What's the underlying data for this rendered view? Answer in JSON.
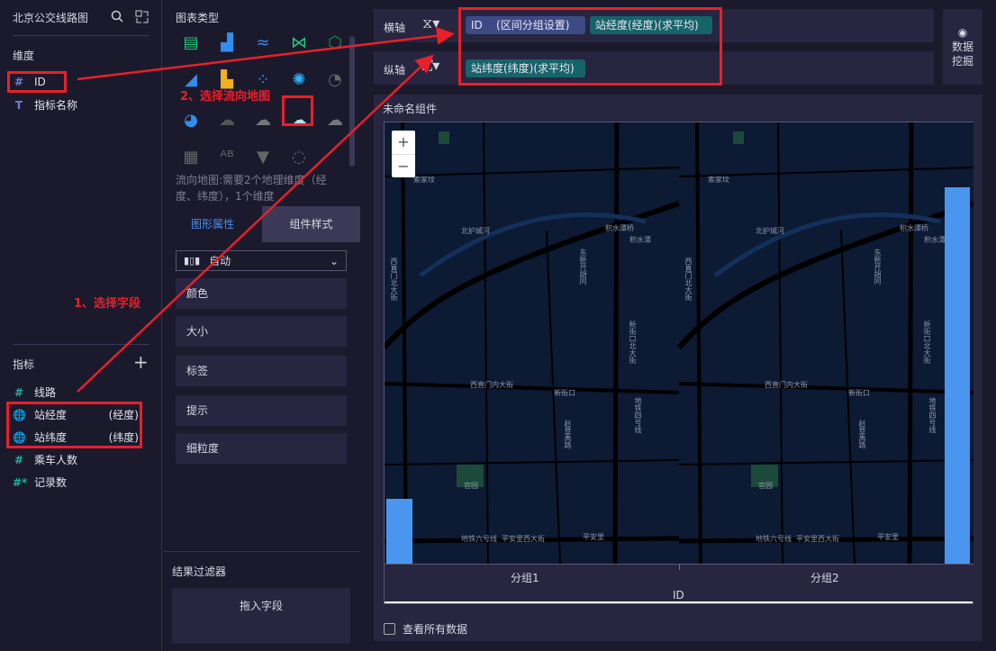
{
  "left": {
    "title": "北京公交线路图",
    "dim_title": "维度",
    "dims": [
      {
        "icon": "#",
        "label": "ID"
      },
      {
        "icon": "T",
        "label": "指标名称"
      }
    ],
    "meas_title": "指标",
    "measures": [
      {
        "icon": "#",
        "label": "线路",
        "tag": ""
      },
      {
        "icon": "globe",
        "label": "站经度",
        "tag": "(经度)"
      },
      {
        "icon": "globe",
        "label": "站纬度",
        "tag": "(纬度)"
      },
      {
        "icon": "#",
        "label": "乘车人数",
        "tag": ""
      },
      {
        "icon": "#*",
        "label": "记录数",
        "tag": ""
      }
    ]
  },
  "mid": {
    "chart_type_title": "图表类型",
    "selected_chart": "flow-map",
    "desc": "流向地图:需要2个地理维度（经度、纬度），1个维度",
    "tabs": [
      "图形属性",
      "组件样式"
    ],
    "active_tab": 0,
    "select_value": "自动",
    "props": [
      "颜色",
      "大小",
      "标签",
      "提示",
      "细粒度"
    ],
    "filter_title": "结果过滤器",
    "filter_drop": "拖入字段"
  },
  "axes": {
    "x_label": "横轴",
    "y_label": "纵轴",
    "x_chips": [
      {
        "text": "ID",
        "sub": "(区间分组设置)",
        "color": "#3d4a86"
      },
      {
        "text": "站经度(经度)(求平均)",
        "color": "#17636a"
      }
    ],
    "y_chips": [
      {
        "text": "站纬度(纬度)(求平均)",
        "color": "#17636a"
      }
    ],
    "mining": "数据挖掘"
  },
  "widget": {
    "title": "未命名组件",
    "zoom_in": "+",
    "zoom_out": "−",
    "groups": [
      "分组1",
      "分组2"
    ],
    "x_title": "ID",
    "show_all": "查看所有数据",
    "bar_color": "#4a96ee",
    "map_labels": [
      "索家坟",
      "北护城河",
      "积水潭桥",
      "积水潭",
      "西直门北大街",
      "东新开胡同",
      "新街口北大街",
      "西直门内大街",
      "新街口",
      "地铁四号线",
      "赵登禹路",
      "官园",
      "地铁六号线",
      "平安里西大街",
      "平安里"
    ]
  },
  "annotations": {
    "step1": "1、选择字段",
    "step2": "2、选择流向地图",
    "color": "#e8202a"
  }
}
